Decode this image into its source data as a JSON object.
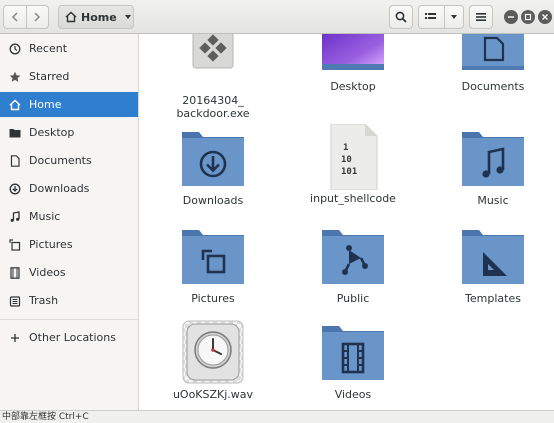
{
  "header": {
    "path_label": "Home"
  },
  "sidebar": {
    "items": [
      {
        "label": "Recent",
        "icon": "clock-icon"
      },
      {
        "label": "Starred",
        "icon": "star-icon"
      },
      {
        "label": "Home",
        "icon": "home-icon",
        "active": true
      },
      {
        "label": "Desktop",
        "icon": "desktop-folder-icon"
      },
      {
        "label": "Documents",
        "icon": "document-icon"
      },
      {
        "label": "Downloads",
        "icon": "download-icon"
      },
      {
        "label": "Music",
        "icon": "music-note-icon"
      },
      {
        "label": "Pictures",
        "icon": "picture-icon"
      },
      {
        "label": "Videos",
        "icon": "film-icon"
      },
      {
        "label": "Trash",
        "icon": "trash-icon"
      }
    ],
    "other_locations": "Other Locations"
  },
  "files": [
    {
      "label": "20164304_\nbackdoor.exe",
      "icon": "exe-icon"
    },
    {
      "label": "Desktop",
      "icon": "desktop-folder-icon"
    },
    {
      "label": "Documents",
      "icon": "documents-folder-icon"
    },
    {
      "label": "Downloads",
      "icon": "downloads-folder-icon"
    },
    {
      "label": "input_shellcode",
      "icon": "binary-file-icon"
    },
    {
      "label": "Music",
      "icon": "music-folder-icon"
    },
    {
      "label": "Pictures",
      "icon": "pictures-folder-icon"
    },
    {
      "label": "Public",
      "icon": "public-folder-icon"
    },
    {
      "label": "Templates",
      "icon": "templates-folder-icon"
    },
    {
      "label": "uOoKSZKj.wav",
      "icon": "audio-file-icon"
    },
    {
      "label": "Videos",
      "icon": "videos-folder-icon"
    }
  ],
  "statusbar": {
    "text": "中部靠左框按 Ctrl+C"
  },
  "colors": {
    "accent": "#2f7fd1",
    "folder": "#5f8ec2"
  }
}
